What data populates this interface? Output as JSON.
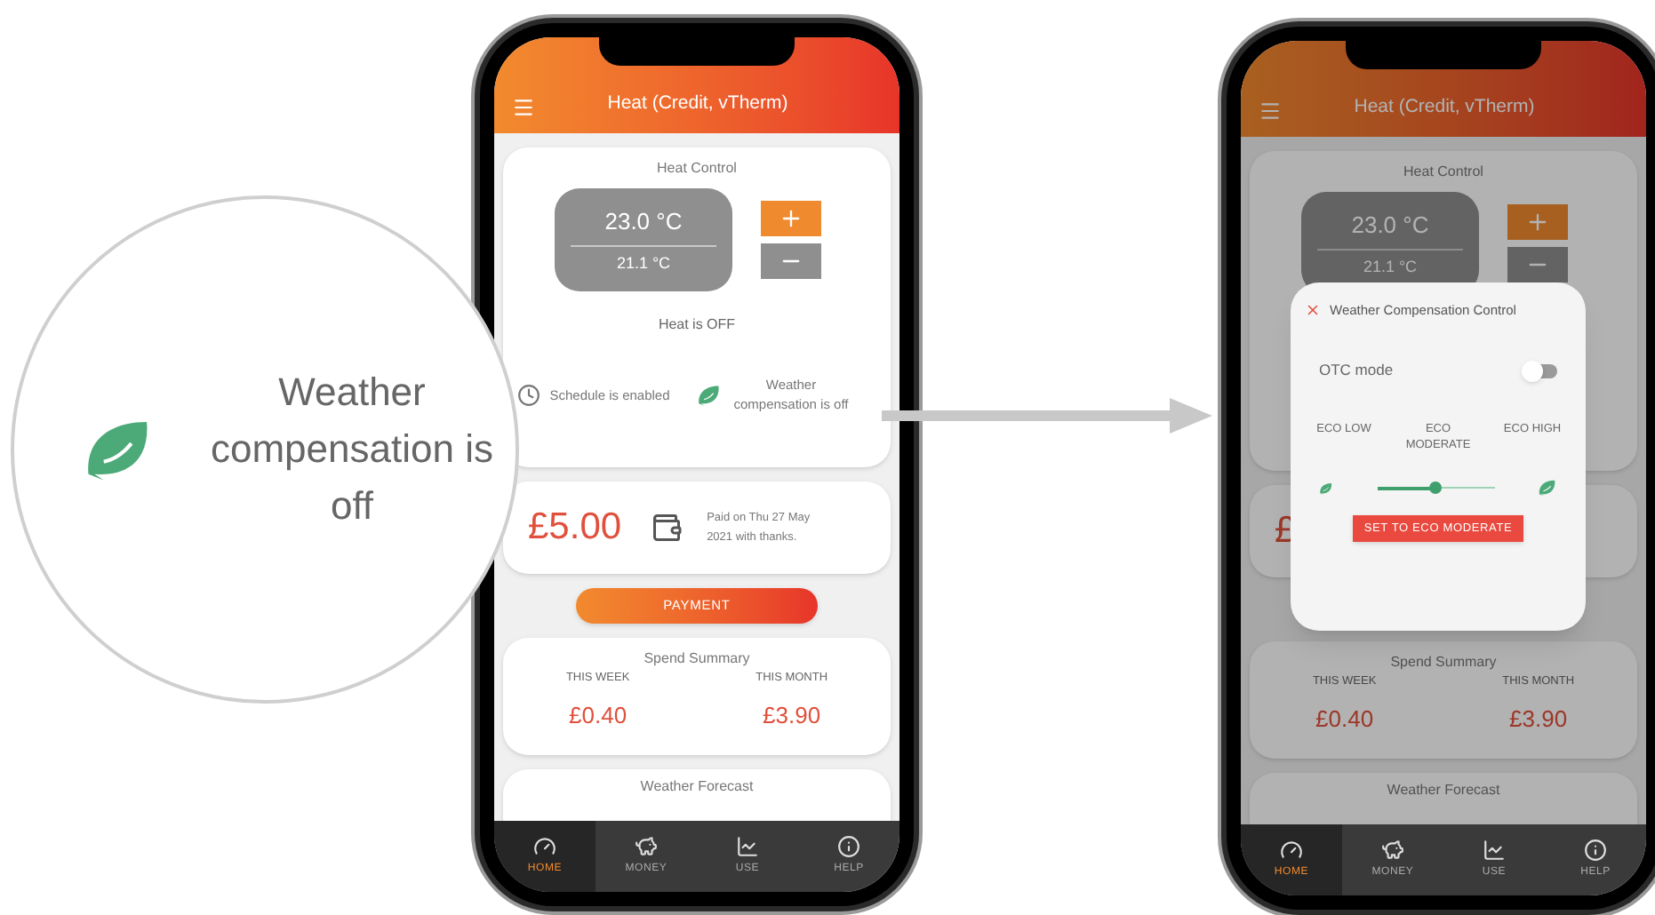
{
  "callout": {
    "text": "Weather compensation is off"
  },
  "phones": [
    {
      "header": {
        "title": "Heat (Credit, vTherm)"
      },
      "heat_control": {
        "title": "Heat Control",
        "setpoint": "23.0 °C",
        "current": "21.1 °C",
        "status": "Heat is OFF",
        "schedule": "Schedule is enabled",
        "weather_compensation": "Weather compensation is off"
      },
      "payment": {
        "amount": "£5.00",
        "note": "Paid on Thu 27 May 2021 with thanks.",
        "button": "PAYMENT"
      },
      "spend_summary": {
        "title": "Spend Summary",
        "periods": [
          {
            "label": "THIS WEEK",
            "value": "£0.40"
          },
          {
            "label": "THIS MONTH",
            "value": "£3.90"
          }
        ]
      },
      "weather_forecast": {
        "title": "Weather Forecast"
      },
      "nav": [
        {
          "label": "HOME",
          "selected": true,
          "kind": "gauge"
        },
        {
          "label": "MONEY",
          "selected": false,
          "kind": "piggy"
        },
        {
          "label": "USE",
          "selected": false,
          "kind": "chart"
        },
        {
          "label": "HELP",
          "selected": false,
          "kind": "info"
        }
      ]
    },
    {
      "header": {
        "title": "Heat (Credit, vTherm)"
      },
      "heat_control": {
        "title": "Heat Control",
        "setpoint": "23.0 °C",
        "current": "21.1 °C"
      },
      "payment": {
        "amount": "£"
      },
      "spend_summary": {
        "title": "Spend Summary",
        "periods": [
          {
            "label": "THIS WEEK",
            "value": "£0.40"
          },
          {
            "label": "THIS MONTH",
            "value": "£3.90"
          }
        ]
      },
      "weather_forecast": {
        "title": "Weather Forecast"
      },
      "nav": [
        {
          "label": "HOME",
          "selected": true,
          "kind": "gauge"
        },
        {
          "label": "MONEY",
          "selected": false,
          "kind": "piggy"
        },
        {
          "label": "USE",
          "selected": false,
          "kind": "chart"
        },
        {
          "label": "HELP",
          "selected": false,
          "kind": "info"
        }
      ],
      "dialog": {
        "title": "Weather Compensation Control",
        "otc_label": "OTC mode",
        "otc_on": false,
        "levels": [
          "ECO LOW",
          "ECO MODERATE",
          "ECO HIGH"
        ],
        "level": 0.5,
        "button": "SET TO ECO MODERATE"
      }
    }
  ]
}
